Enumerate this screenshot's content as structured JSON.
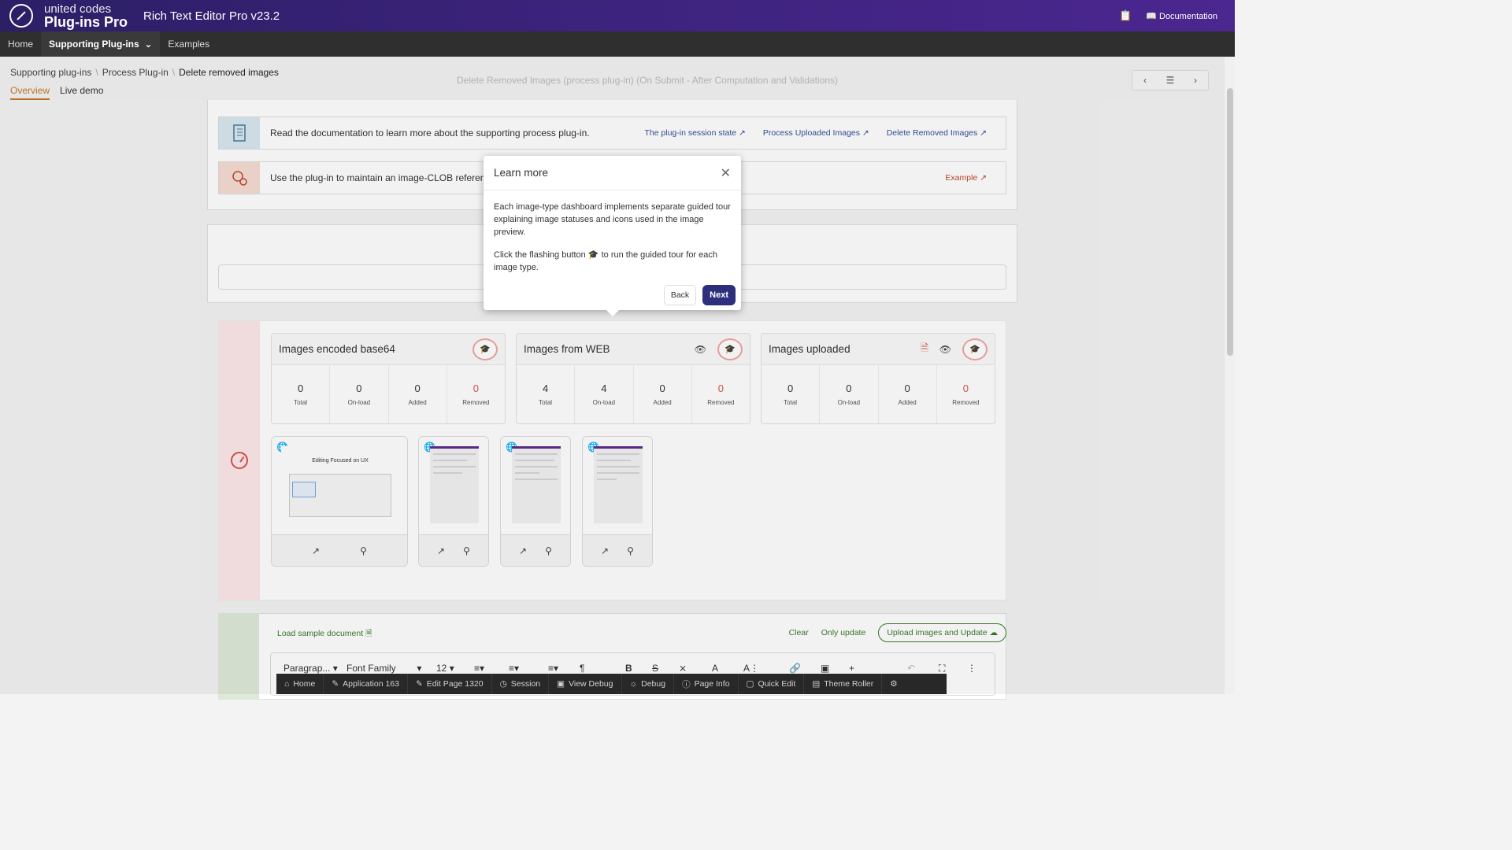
{
  "header": {
    "brand_top": "united codes",
    "brand_bottom": "Plug-ins Pro",
    "app_title": "Rich Text Editor Pro v23.2",
    "documentation": "Documentation"
  },
  "nav": {
    "items": [
      {
        "label": "Home"
      },
      {
        "label": "Supporting Plug-ins"
      },
      {
        "label": "Examples"
      }
    ]
  },
  "breadcrumb": {
    "items": [
      "Supporting plug-ins",
      "Process Plug-in",
      "Delete removed images"
    ],
    "tabs": [
      "Overview",
      "Live demo"
    ]
  },
  "ghost": {
    "line1": "Delete Removed Images (process plug-in) (On Submit - After Computation and Validations)"
  },
  "info_rows": [
    {
      "text": "Read the documentation to learn more about the supporting process plug-in.",
      "links": [
        "The plug-in session state",
        "Process Uploaded Images",
        "Delete Removed Images"
      ]
    },
    {
      "text": "Use the plug-in to maintain an image-CLOB reference",
      "links": [
        "Example"
      ]
    }
  ],
  "cards": [
    {
      "title": "Images encoded base64",
      "stats": [
        {
          "value": "0",
          "label": "Total"
        },
        {
          "value": "0",
          "label": "On-load"
        },
        {
          "value": "0",
          "label": "Added"
        },
        {
          "value": "0",
          "label": "Removed"
        }
      ]
    },
    {
      "title": "Images from WEB",
      "stats": [
        {
          "value": "4",
          "label": "Total"
        },
        {
          "value": "4",
          "label": "On-load"
        },
        {
          "value": "0",
          "label": "Added"
        },
        {
          "value": "0",
          "label": "Removed"
        }
      ]
    },
    {
      "title": "Images uploaded",
      "stats": [
        {
          "value": "0",
          "label": "Total"
        },
        {
          "value": "0",
          "label": "On-load"
        },
        {
          "value": "0",
          "label": "Added"
        },
        {
          "value": "0",
          "label": "Removed"
        }
      ]
    }
  ],
  "thumb_caption": "Editing Focused on UX",
  "editor": {
    "load_sample": "Load sample document",
    "clear": "Clear",
    "only_update": "Only update",
    "upload_update": "Upload images and Update",
    "paragraph": "Paragrap...",
    "font_family": "Font Family",
    "font_size": "12"
  },
  "devbar": {
    "items": [
      "Home",
      "Application 163",
      "Edit Page 1320",
      "Session",
      "View Debug",
      "Debug",
      "Page Info",
      "Quick Edit",
      "Theme Roller"
    ]
  },
  "modal": {
    "title": "Learn more",
    "p1": "Each image-type dashboard implements separate guided tour explaining image statuses and icons used in the image preview.",
    "p2_before": "Click the flashing button",
    "p2_after": "to run the guided tour for each image type.",
    "back": "Back",
    "next": "Next"
  },
  "colors": {
    "header_gradient": "#3d237d",
    "accent_orange": "#c77a2a",
    "removed_red": "#d9534f",
    "next_button": "#2d2f7d"
  }
}
